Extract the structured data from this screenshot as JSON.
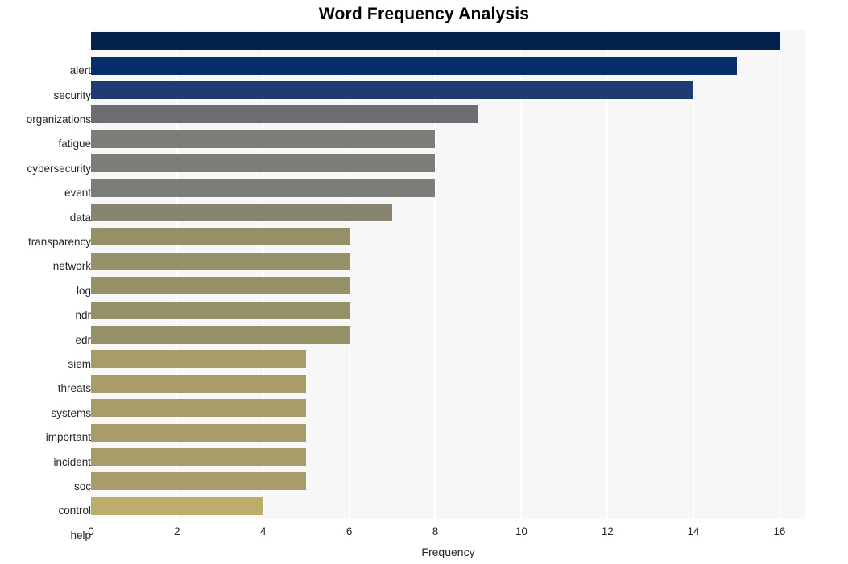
{
  "chart_data": {
    "type": "bar",
    "orientation": "horizontal",
    "title": "Word Frequency Analysis",
    "xlabel": "Frequency",
    "ylabel": "",
    "categories": [
      "alert",
      "security",
      "organizations",
      "fatigue",
      "cybersecurity",
      "event",
      "data",
      "transparency",
      "network",
      "log",
      "ndr",
      "edr",
      "siem",
      "threats",
      "systems",
      "important",
      "incident",
      "soc",
      "control",
      "help"
    ],
    "values": [
      16,
      15,
      14,
      9,
      8,
      8,
      8,
      7,
      6,
      6,
      6,
      6,
      6,
      5,
      5,
      5,
      5,
      5,
      5,
      4
    ],
    "bar_colors": [
      "#03214d",
      "#042f6b",
      "#1d3c74",
      "#6b6d73",
      "#7c7c79",
      "#7c7c79",
      "#7c7c79",
      "#88846f",
      "#969068",
      "#969068",
      "#969068",
      "#969068",
      "#969068",
      "#a89c69",
      "#a89c69",
      "#a89c69",
      "#a89c69",
      "#a89c69",
      "#a89c69",
      "#bdad6a"
    ],
    "xlim": [
      0,
      16.6
    ],
    "xticks": [
      0,
      2,
      4,
      6,
      8,
      10,
      12,
      14,
      16
    ],
    "xtick_labels": [
      "0",
      "2",
      "4",
      "6",
      "8",
      "10",
      "12",
      "14",
      "16"
    ],
    "grid": "vertical",
    "grid_color": "#ffffff",
    "plot_background": "#f7f7f7",
    "figure_background": "#ffffff",
    "legend": "none"
  }
}
